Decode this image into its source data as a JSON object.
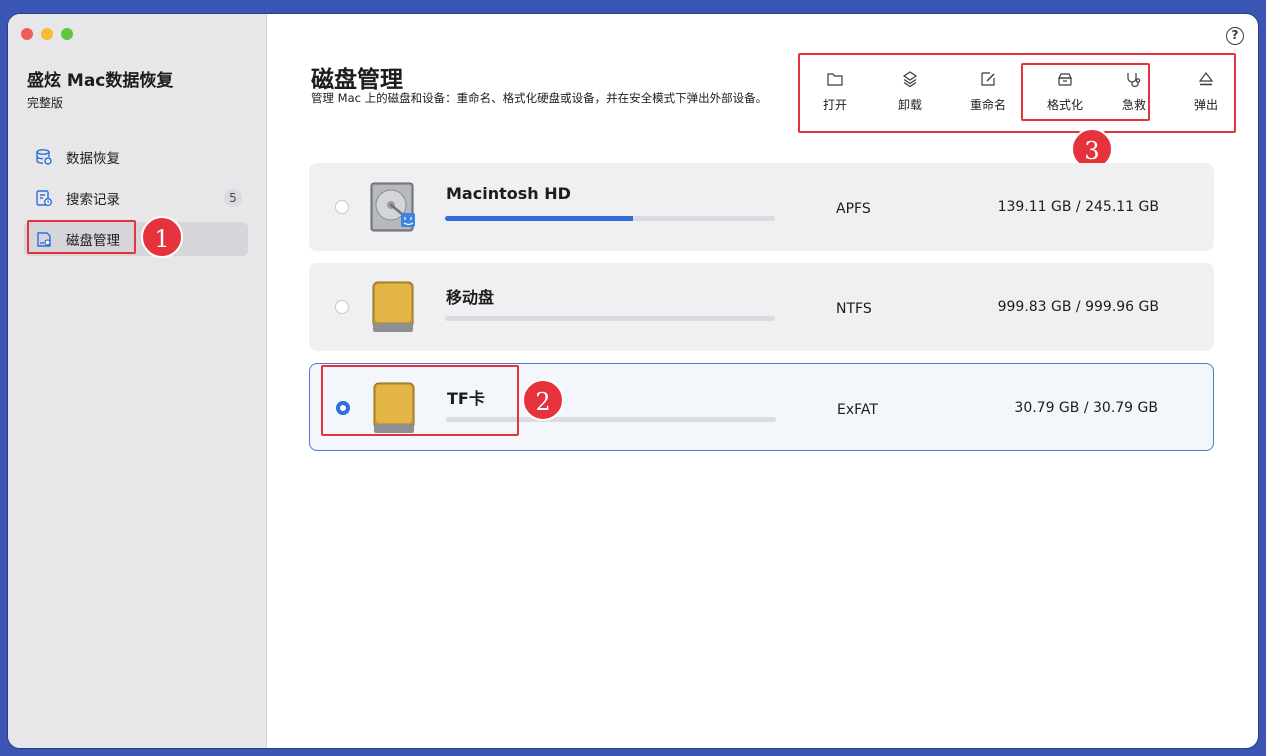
{
  "app": {
    "title": "盛炫 Mac数据恢复",
    "edition": "完整版"
  },
  "sidebar": {
    "items": [
      {
        "label": "数据恢复",
        "icon": "database-recovery-icon",
        "badge": ""
      },
      {
        "label": "搜索记录",
        "icon": "search-history-icon",
        "badge": "5"
      },
      {
        "label": "磁盘管理",
        "icon": "disk-manage-icon",
        "badge": "",
        "active": true
      }
    ]
  },
  "main": {
    "title": "磁盘管理",
    "description": "管理 Mac 上的磁盘和设备：重命名、格式化硬盘或设备，并在安全模式下弹出外部设备。",
    "help_icon": "?"
  },
  "toolbar": {
    "items": [
      {
        "label": "打开",
        "icon": "folder-icon"
      },
      {
        "label": "卸载",
        "icon": "unmount-icon"
      },
      {
        "label": "重命名",
        "icon": "rename-icon"
      },
      {
        "label": "格式化",
        "icon": "format-icon"
      },
      {
        "label": "急救",
        "icon": "first-aid-icon"
      },
      {
        "label": "弹出",
        "icon": "eject-icon"
      }
    ]
  },
  "disks": [
    {
      "name": "Macintosh HD",
      "fs": "APFS",
      "size": "139.11 GB / 245.11 GB",
      "usage": 0.57,
      "selected": false
    },
    {
      "name": "移动盘",
      "fs": "NTFS",
      "size": "999.83 GB / 999.96 GB",
      "usage": 0.0,
      "selected": false
    },
    {
      "name": "TF卡",
      "fs": "ExFAT",
      "size": "30.79 GB / 30.79 GB",
      "usage": 0.0,
      "selected": true
    }
  ],
  "markers": [
    "1",
    "2",
    "3"
  ],
  "colors": {
    "accent": "#2f6fd8",
    "highlight": "#e5323c",
    "background": "#3a55b4"
  }
}
